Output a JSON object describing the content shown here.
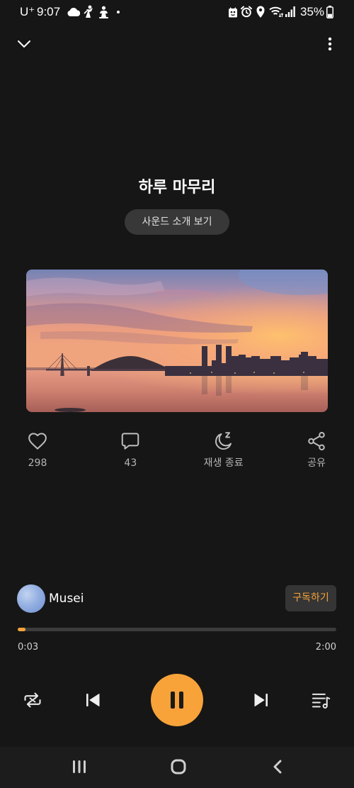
{
  "status_bar": {
    "carrier": "U⁺",
    "time": "9:07",
    "battery_percent": "35%",
    "battery_level": 0.35,
    "left_icons": [
      "cloud-icon",
      "notification-icon",
      "notification-icon",
      "more-notifications-dot"
    ],
    "right_icons": [
      "app-status-icon",
      "alarm-icon",
      "location-icon",
      "wifi-icon",
      "signal-icon",
      "battery-icon"
    ]
  },
  "header": {
    "collapse_icon": "chevron-down-icon",
    "menu_icon": "more-vertical-icon"
  },
  "track": {
    "title": "하루 마무리",
    "intro_button_label": "사운드 소개 보기"
  },
  "actions": [
    {
      "icon": "heart-icon",
      "label": "298"
    },
    {
      "icon": "comment-icon",
      "label": "43"
    },
    {
      "icon": "sleep-timer-icon",
      "label": "재생 종료"
    },
    {
      "icon": "share-icon",
      "label": "공유"
    }
  ],
  "channel": {
    "name": "Musei",
    "subscribe_label": "구독하기"
  },
  "player": {
    "elapsed": "0:03",
    "duration": "2:00",
    "progress": 0.025
  },
  "controls": [
    "repeat-icon",
    "previous-icon",
    "pause-icon",
    "next-icon",
    "playlist-icon"
  ],
  "nav_bar": [
    "recent-apps-icon",
    "home-icon",
    "back-icon"
  ],
  "colors": {
    "accent": "#F7A33A",
    "background": "#161616",
    "surface": "#383838",
    "text": "#FFFFFF",
    "muted_text": "#B4B4B4"
  }
}
